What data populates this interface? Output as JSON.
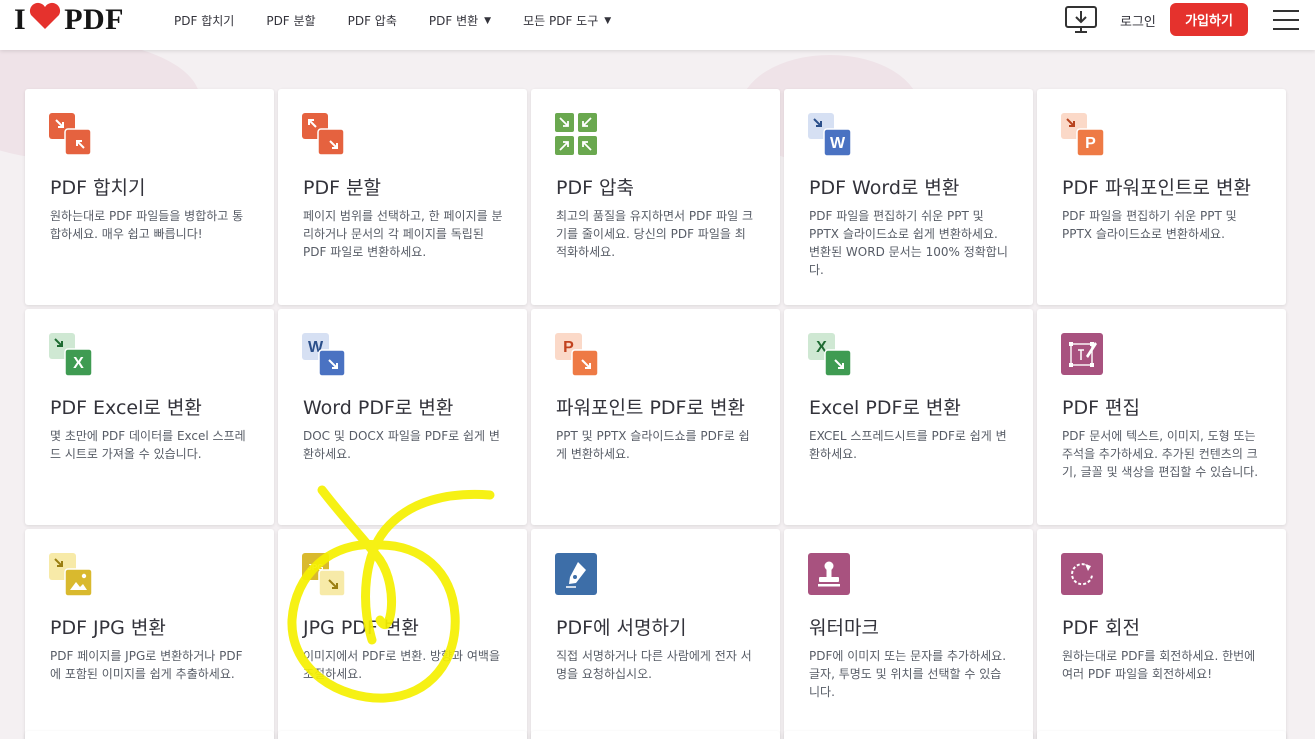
{
  "header": {
    "logo_text_left": "I",
    "logo_text_right": "PDF",
    "nav": [
      {
        "label": "PDF 합치기"
      },
      {
        "label": "PDF 분할"
      },
      {
        "label": "PDF 압축"
      },
      {
        "label": "PDF 변환",
        "has_dropdown": true
      },
      {
        "label": "모든 PDF 도구",
        "has_dropdown": true
      }
    ],
    "login_label": "로그인",
    "signup_label": "가입하기"
  },
  "tools": [
    {
      "title": "PDF 합치기",
      "desc": "원하는대로 PDF 파일들을 병합하고 통합하세요. 매우 쉽고 빠릅니다!",
      "icon": "merge-icon",
      "color": "#e5623f"
    },
    {
      "title": "PDF 분할",
      "desc": "페이지 범위를 선택하고, 한 페이지를 분리하거나 문서의 각 페이지를 독립된 PDF 파일로 변환하세요.",
      "icon": "split-icon",
      "color": "#e5623f"
    },
    {
      "title": "PDF 압축",
      "desc": "최고의 품질을 유지하면서 PDF 파일 크기를 줄이세요. 당신의 PDF 파일을 최적화하세요.",
      "icon": "compress-icon",
      "color": "#6aa84f"
    },
    {
      "title": "PDF Word로 변환",
      "desc": "PDF 파일을 편집하기 쉬운 PPT 및 PPTX 슬라이드쇼로 쉽게 변환하세요. 변환된 WORD 문서는 100% 정확합니다.",
      "icon": "pdf-to-word-icon",
      "color": "#4a72c2"
    },
    {
      "title": "PDF 파워포인트로 변환",
      "desc": "PDF 파일을 편집하기 쉬운 PPT 및 PPTX 슬라이드쇼로 변환하세요.",
      "icon": "pdf-to-powerpoint-icon",
      "color": "#ee7a45"
    },
    {
      "title": "PDF Excel로 변환",
      "desc": "몇 초만에 PDF 데이터를 Excel 스프레드 시트로 가져올 수 있습니다.",
      "icon": "pdf-to-excel-icon",
      "color": "#3f9b52"
    },
    {
      "title": "Word PDF로 변환",
      "desc": "DOC 및 DOCX 파일을 PDF로 쉽게 변환하세요.",
      "icon": "word-to-pdf-icon",
      "color": "#4a72c2"
    },
    {
      "title": "파워포인트 PDF로 변환",
      "desc": "PPT 및 PPTX 슬라이드쇼를 PDF로 쉽게 변환하세요.",
      "icon": "powerpoint-to-pdf-icon",
      "color": "#ee7a45"
    },
    {
      "title": "Excel PDF로 변환",
      "desc": "EXCEL 스프레드시트를 PDF로 쉽게 변환하세요.",
      "icon": "excel-to-pdf-icon",
      "color": "#3f9b52"
    },
    {
      "title": "PDF 편집",
      "desc": "PDF 문서에 텍스트, 이미지, 도형 또는 주석을 추가하세요. 추가된 컨텐츠의 크기, 글꼴 및 색상을 편집할 수 있습니다.",
      "icon": "edit-pdf-icon",
      "color": "#a8527f"
    },
    {
      "title": "PDF JPG 변환",
      "desc": "PDF 페이지를 JPG로 변환하거나 PDF에 포함된 이미지를 쉽게 추출하세요.",
      "icon": "pdf-to-jpg-icon",
      "color": "#d9b92e"
    },
    {
      "title": "JPG PDF 변환",
      "desc": "이미지에서 PDF로 변환. 방향과 여백을 조절하세요.",
      "icon": "jpg-to-pdf-icon",
      "color": "#d9b92e"
    },
    {
      "title": "PDF에 서명하기",
      "desc": "직접 서명하거나 다른 사람에게 전자 서명을 요청하십시오.",
      "icon": "sign-pdf-icon",
      "color": "#3d6ea8"
    },
    {
      "title": "워터마크",
      "desc": "PDF에 이미지 또는 문자를 추가하세요. 글자, 투명도 및 위치를 선택할 수 있습니다.",
      "icon": "watermark-icon",
      "color": "#a8527f"
    },
    {
      "title": "PDF 회전",
      "desc": "원하는대로 PDF를 회전하세요. 한번에 여러 PDF 파일을 회전하세요!",
      "icon": "rotate-pdf-icon",
      "color": "#a8527f"
    }
  ],
  "icon_labels": {
    "word": "W",
    "powerpoint": "P",
    "excel": "X",
    "jpg": "JPG"
  }
}
